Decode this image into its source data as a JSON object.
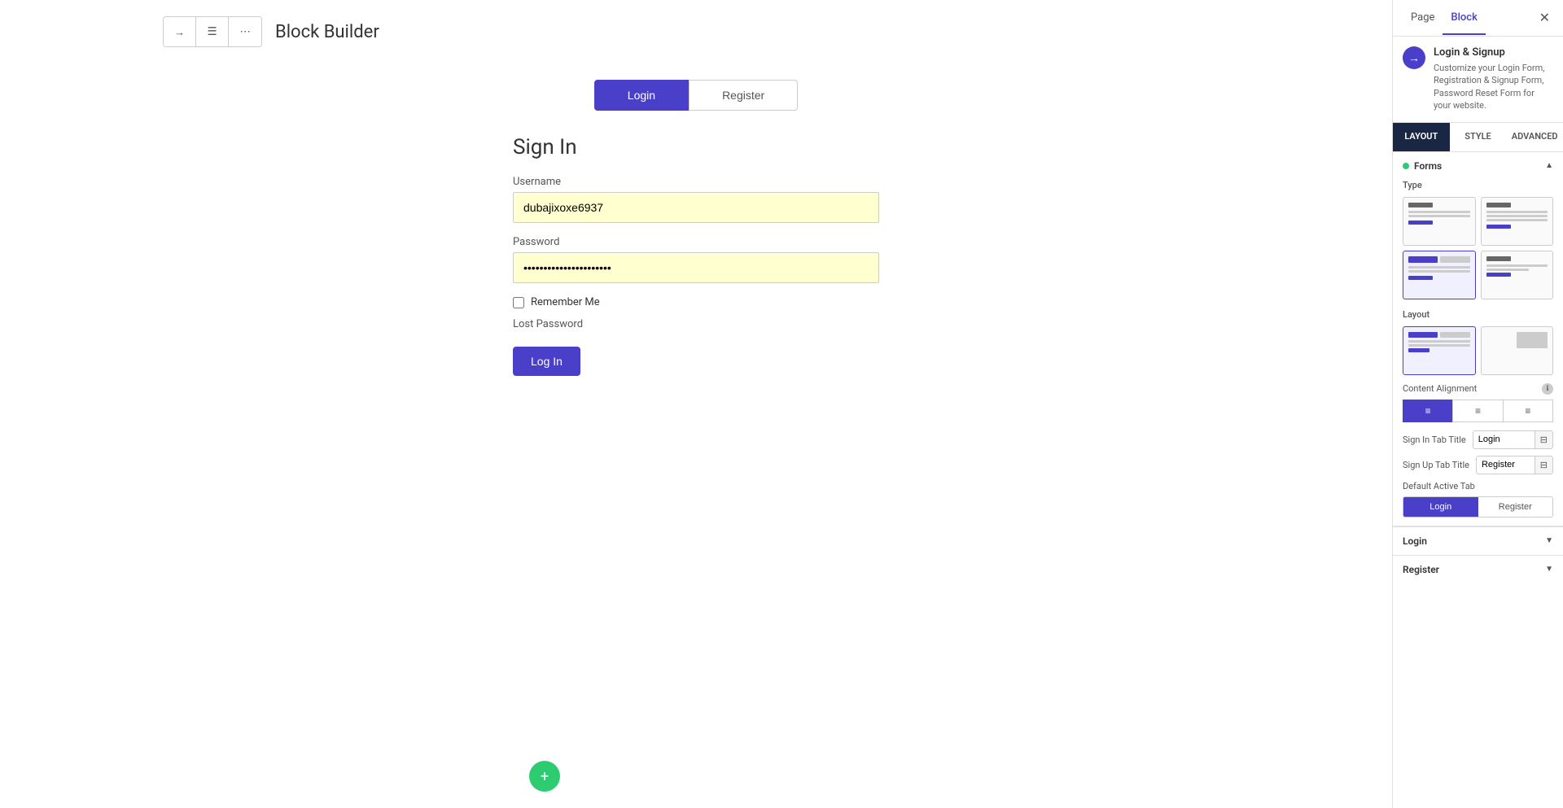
{
  "header": {
    "title": "Block Builder",
    "toolbar": {
      "loginIcon": "→",
      "listIcon": "☰",
      "moreIcon": "⋯"
    }
  },
  "canvas": {
    "tabs": {
      "loginLabel": "Login",
      "registerLabel": "Register"
    },
    "form": {
      "title": "Sign In",
      "usernamLabel": "Username",
      "usernameValue": "dubajixoxe6937",
      "passwordLabel": "Password",
      "passwordValue": "••••••••••••••••••••",
      "rememberLabel": "Remember Me",
      "lostPasswordLabel": "Lost Password",
      "loginBtnLabel": "Log In"
    }
  },
  "sidebar": {
    "tabs": {
      "pageLabel": "Page",
      "blockLabel": "Block"
    },
    "pluginInfo": {
      "icon": "→",
      "title": "Login & Signup",
      "description": "Customize your Login Form, Registration & Signup Form, Password Reset Form for your website."
    },
    "layoutTabs": {
      "layout": "LAYOUT",
      "style": "STYLE",
      "advanced": "ADVANCED"
    },
    "forms": {
      "sectionTitle": "Forms",
      "typeLabel": "Type",
      "layoutLabel": "Layout",
      "contentAlignmentLabel": "Content Alignment",
      "alignLeft": "≡",
      "alignCenter": "≡",
      "alignRight": "≡",
      "signInTabTitleLabel": "Sign In Tab Title",
      "signInTabTitleValue": "Login",
      "signUpTabTitleLabel": "Sign Up Tab Title",
      "signUpTabTitleValue": "Register",
      "defaultActiveTabLabel": "Default Active Tab",
      "defaultLoginLabel": "Login",
      "defaultRegisterLabel": "Register"
    },
    "loginSection": {
      "title": "Login"
    },
    "registerSection": {
      "title": "Register"
    }
  }
}
